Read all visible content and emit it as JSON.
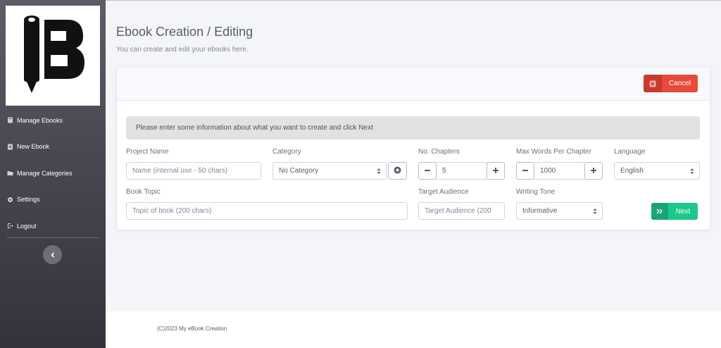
{
  "logo": {
    "letter": "B"
  },
  "sidebar": {
    "items": [
      {
        "label": "Manage Ebooks",
        "icon": "book-icon"
      },
      {
        "label": "New Ebook",
        "icon": "file-icon"
      },
      {
        "label": "Manage Categories",
        "icon": "folder-icon"
      },
      {
        "label": "Settings",
        "icon": "gear-icon"
      },
      {
        "label": "Logout",
        "icon": "logout-icon"
      }
    ],
    "collapse_icon": "chevron-left-icon"
  },
  "page": {
    "title": "Ebook Creation / Editing",
    "subtitle": "You can create and edit your ebooks here."
  },
  "card": {
    "cancel_label": "Cancel",
    "info_text": "Please enter some information about what you want to create and click Next",
    "next_label": "Next"
  },
  "form": {
    "project_name": {
      "label": "Project Name",
      "placeholder": "Name (internal use - 50 chars)",
      "value": ""
    },
    "category": {
      "label": "Category",
      "selected": "No Category"
    },
    "chapters": {
      "label": "No. Chapters",
      "value": "5"
    },
    "max_words": {
      "label": "Max Words Per Chapter",
      "value": "1000"
    },
    "language": {
      "label": "Language",
      "selected": "English"
    },
    "book_topic": {
      "label": "Book Topic",
      "placeholder": "Topic of book (200 chars)",
      "value": ""
    },
    "target_audience": {
      "label": "Target Audience",
      "placeholder": "Target Audience (200",
      "value": ""
    },
    "writing_tone": {
      "label": "Writing Tone",
      "selected": "Informative"
    }
  },
  "footer": {
    "text": "(C)2023 My eBook Creation"
  },
  "colors": {
    "danger": "#e74a3b",
    "success": "#1cc88a",
    "sidebar": "#4a4a54"
  }
}
